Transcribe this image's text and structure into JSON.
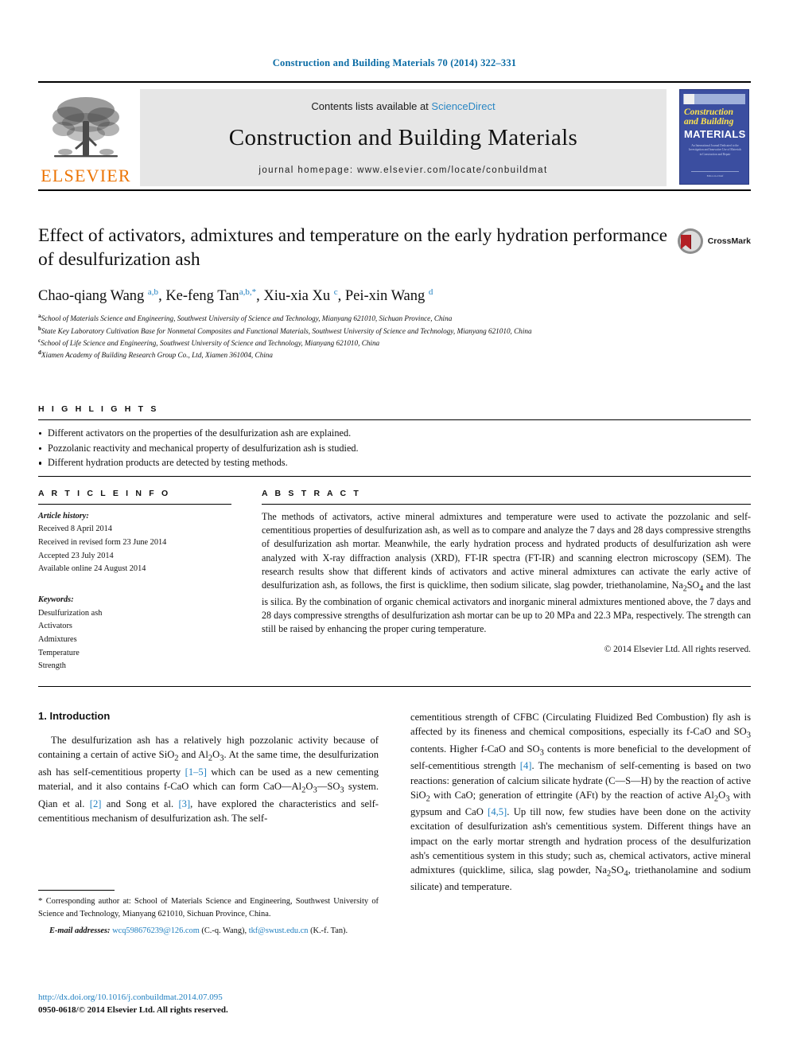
{
  "running_head": "Construction and Building Materials 70 (2014) 322–331",
  "masthead": {
    "contents_prefix": "Contents lists available at ",
    "sciencedirect": "ScienceDirect",
    "journal_title": "Construction and Building Materials",
    "journal_homepage": "journal homepage: www.elsevier.com/locate/conbuildmat",
    "publisher_wordmark": "ELSEVIER",
    "publisher_logo_icon": "elsevier-tree-icon",
    "cover": {
      "line1": "Construction",
      "line2": "and Building",
      "line3": "MATERIALS",
      "subtitle": "An International Journal Dedicated to the Investigation and Innovative Use of Materials in Construction and Repair",
      "footer": "Editor-in-Chief"
    }
  },
  "article": {
    "title": "Effect of activators, admixtures and temperature on the early hydration performance of desulfurization ash",
    "crossmark_label": "CrossMark",
    "crossmark_icon": "crossmark-shield-icon",
    "authors_html": "Chao-qiang Wang <sup>a,b</sup>, Ke-feng Tan<sup>a,b,</sup><sup>*</sup>, Xiu-xia Xu <sup>c</sup>, Pei-xin Wang <sup>d</sup>",
    "affiliations": [
      {
        "marker": "a",
        "text": "School of Materials Science and Engineering, Southwest University of Science and Technology, Mianyang 621010, Sichuan Province, China"
      },
      {
        "marker": "b",
        "text": "State Key Laboratory Cultivation Base for Nonmetal Composites and Functional Materials, Southwest University of Science and Technology, Mianyang 621010, China"
      },
      {
        "marker": "c",
        "text": "School of Life Science and Engineering, Southwest University of Science and Technology, Mianyang 621010, China"
      },
      {
        "marker": "d",
        "text": "Xiamen Academy of Building Research Group Co., Ltd, Xiamen 361004, China"
      }
    ]
  },
  "highlights": {
    "heading": "H I G H L I G H T S",
    "items": [
      "Different activators on the properties of the desulfurization ash are explained.",
      "Pozzolanic reactivity and mechanical property of desulfurization ash is studied.",
      "Different hydration products are detected by testing methods."
    ]
  },
  "article_info": {
    "heading": "A R T I C L E   I N F O",
    "history_label": "Article history:",
    "history": [
      "Received 8 April 2014",
      "Received in revised form 23 June 2014",
      "Accepted 23 July 2014",
      "Available online 24 August 2014"
    ],
    "keywords_label": "Keywords:",
    "keywords": [
      "Desulfurization ash",
      "Activators",
      "Admixtures",
      "Temperature",
      "Strength"
    ]
  },
  "abstract": {
    "heading": "A B S T R A C T",
    "body_html": "The methods of activators, active mineral admixtures and temperature were used to activate the pozzolanic and self-cementitious properties of desulfurization ash, as well as to compare and analyze the 7 days and 28 days compressive strengths of desulfurization ash mortar. Meanwhile, the early hydration process and hydrated products of desulfurization ash were analyzed with X-ray diffraction analysis (XRD), FT-IR spectra (FT-IR) and scanning electron microscopy (SEM). The research results show that different kinds of activators and active mineral admixtures can activate the early active of desulfurization ash, as follows, the first is quicklime, then sodium silicate, slag powder, triethanolamine, Na<sub>2</sub>SO<sub>4</sub> and the last is silica. By the combination of organic chemical activators and inorganic mineral admixtures mentioned above, the 7 days and 28 days compressive strengths of desulfurization ash mortar can be up to 20 MPa and 22.3 MPa, respectively. The strength can still be raised by enhancing the proper curing temperature.",
    "copyright": "© 2014 Elsevier Ltd. All rights reserved."
  },
  "introduction": {
    "heading": "1. Introduction",
    "left_html": "The desulfurization ash has a relatively high pozzolanic activity because of containing a certain of active SiO<sub>2</sub> and Al<sub>2</sub>O<sub>3</sub>. At the same time, the desulfurization ash has self-cementitious property <span class=\"ref\">[1–5]</span> which can be used as a new cementing material, and it also contains f-CaO which can form CaO—Al<sub>2</sub>O<sub>3</sub>—SO<sub>3</sub> system. Qian et al. <span class=\"ref\">[2]</span> and Song et al. <span class=\"ref\">[3]</span>, have explored the characteristics and self-cementitious mechanism of desulfurization ash. The self-",
    "right_html": "cementitious strength of CFBC (Circulating Fluidized Bed Combustion) fly ash is affected by its fineness and chemical compositions, especially its f-CaO and SO<sub>3</sub> contents. Higher f-CaO and SO<sub>3</sub> contents is more beneficial to the development of self-cementitious strength <span class=\"ref\">[4]</span>. The mechanism of self-cementing is based on two reactions: generation of calcium silicate hydrate (C—S—H) by the reaction of active SiO<sub>2</sub> with CaO; generation of ettringite (AFt) by the reaction of active Al<sub>2</sub>O<sub>3</sub> with gypsum and CaO <span class=\"ref\">[4,5]</span>. Up till now, few studies have been done on the activity excitation of desulfurization ash's cementitious system. Different things have an impact on the early mortar strength and hydration process of the desulfurization ash's cementitious system in this study; such as, chemical activators, active mineral admixtures (quicklime, silica, slag powder, Na<sub>2</sub>SO<sub>4</sub>, triethanolamine and sodium silicate) and temperature."
  },
  "footnotes": {
    "corresponding_html": "<span style=\"font-size:11px\">*</span> Corresponding author at: School of Materials Science and Engineering, Southwest University of Science and Technology, Mianyang 621010, Sichuan Province, China.",
    "email_html": "<span class=\"lbl\">E-mail addresses:</span> <span class=\"link\">wcq598676239@126.com</span> (C.-q. Wang), <span class=\"link\">tkf@swust.edu.cn</span> (K.-f. Tan).",
    "doi": "http://dx.doi.org/10.1016/j.conbuildmat.2014.07.095",
    "issn_line": "0950-0618/© 2014 Elsevier Ltd. All rights reserved."
  },
  "colors": {
    "link_blue": "#1f7fc0",
    "header_blue": "#0b6ca5",
    "elsevier_orange": "#ec7404",
    "cover_blue": "#3b4ea0",
    "cover_yellow": "#ffe44d",
    "banner_gray": "#e6e6e6"
  }
}
